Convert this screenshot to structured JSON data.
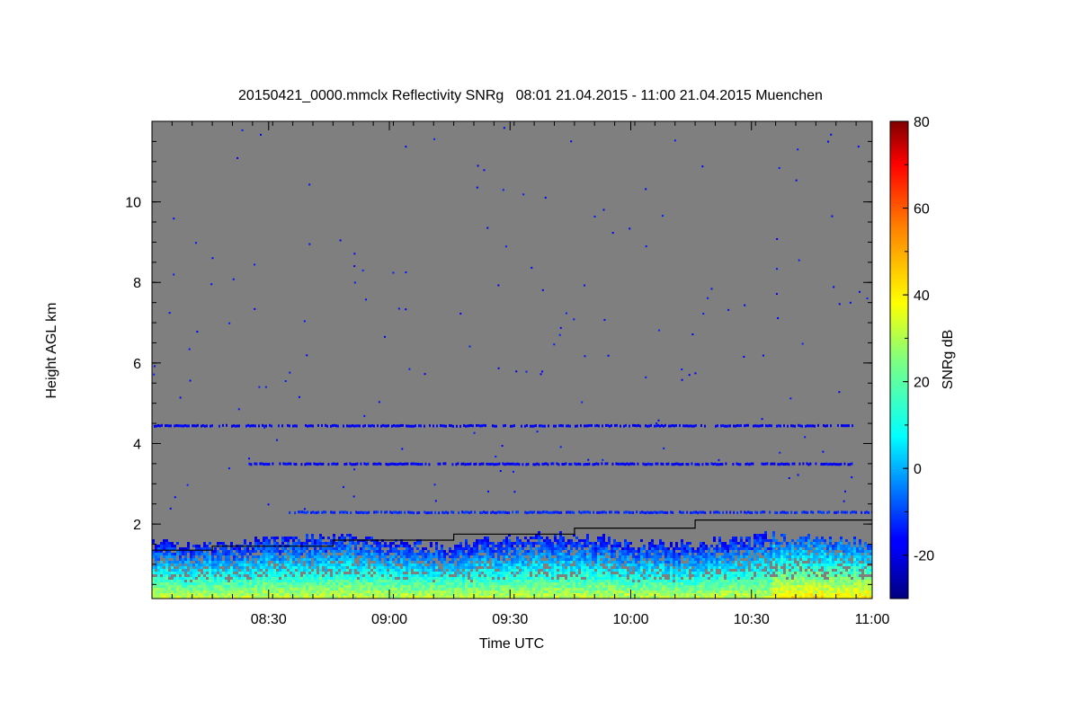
{
  "chart_data": {
    "type": "heatmap",
    "title": "20150421_0000.mmclx Reflectivity SNRg   08:01 21.04.2015 - 11:00 21.04.2015 Muenchen",
    "xlabel": "Time UTC",
    "ylabel": "Height AGL km",
    "colorbar_label": "SNRg dB",
    "x_range_minutes": [
      481,
      660
    ],
    "x_ticks": [
      {
        "minute": 510,
        "label": "08:30"
      },
      {
        "minute": 540,
        "label": "09:00"
      },
      {
        "minute": 570,
        "label": "09:30"
      },
      {
        "minute": 600,
        "label": "10:00"
      },
      {
        "minute": 630,
        "label": "10:30"
      },
      {
        "minute": 660,
        "label": "11:00"
      }
    ],
    "y_range_km": [
      0.15,
      12.0
    ],
    "y_ticks": [
      2,
      4,
      6,
      8,
      10
    ],
    "colorbar_range": [
      -30,
      80
    ],
    "colorbar_ticks": [
      -20,
      0,
      20,
      40,
      60,
      80
    ],
    "background_color": "#7f7f7f",
    "colormap": "jet",
    "boundary_line": {
      "color": "#000000",
      "points": [
        [
          "08:01",
          1.35
        ],
        [
          "08:16",
          1.35
        ],
        [
          "08:16",
          1.45
        ],
        [
          "08:46",
          1.45
        ],
        [
          "08:46",
          1.6
        ],
        [
          "09:16",
          1.6
        ],
        [
          "09:16",
          1.75
        ],
        [
          "09:46",
          1.75
        ],
        [
          "09:46",
          1.9
        ],
        [
          "10:16",
          1.9
        ],
        [
          "10:16",
          2.1
        ],
        [
          "11:00",
          2.1
        ]
      ]
    },
    "echo_bands_km": [
      {
        "height": 4.45,
        "start": "08:01",
        "end": "10:55",
        "snr_db": -20
      },
      {
        "height": 3.5,
        "start": "08:25",
        "end": "10:55",
        "snr_db": -20
      },
      {
        "height": 2.3,
        "start": "08:35",
        "end": "11:00",
        "snr_db": -15
      }
    ],
    "boundary_layer": {
      "top_km": 1.5,
      "snr_db_range": [
        -20,
        30
      ]
    }
  }
}
